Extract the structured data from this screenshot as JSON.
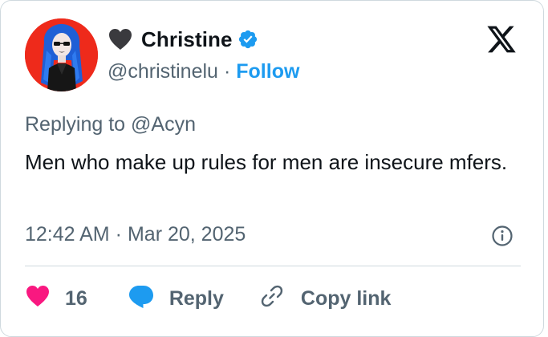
{
  "author": {
    "name": "Christine",
    "handle": "@christinelu",
    "separator": "·",
    "follow_label": "Follow"
  },
  "tweet": {
    "replying_prefix": "Replying to",
    "replying_to": "@Acyn",
    "text": "Men who make up rules for men are insecure mfers.",
    "time": "12:42 AM",
    "meta_separator": "·",
    "date": "Mar 20, 2025"
  },
  "actions": {
    "like_count": "16",
    "reply_label": "Reply",
    "copy_link_label": "Copy link"
  },
  "icons": {
    "name_emoji": "black-heart-icon",
    "verified": "verified-badge-icon",
    "brand": "x-logo-icon",
    "info": "info-icon",
    "like": "heart-icon",
    "reply": "reply-bubble-icon",
    "copy": "link-icon"
  },
  "colors": {
    "like": "#f91880",
    "reply": "#1d9bf0",
    "follow": "#1d9bf0",
    "verified": "#1d9bf0",
    "secondary_text": "#536471",
    "avatar_bg": "#ee2a1b"
  }
}
